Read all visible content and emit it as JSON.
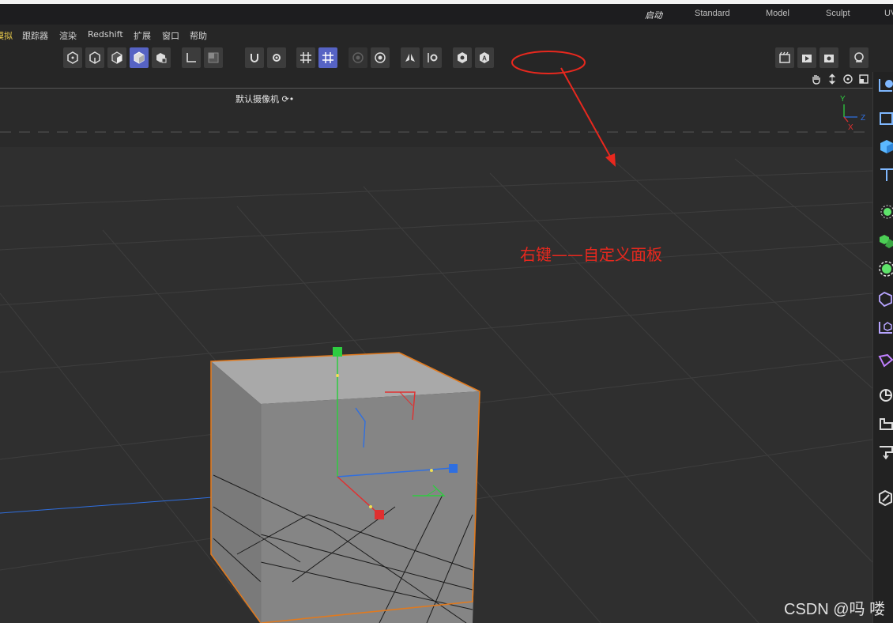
{
  "layout_tabs": [
    "启动",
    "Standard",
    "Model",
    "Sculpt",
    "UV"
  ],
  "menu": [
    "模拟",
    "跟踪器",
    "渲染",
    "Redshift",
    "扩展",
    "窗口",
    "帮助"
  ],
  "viewport": {
    "camera_label": "默认摄像机 ⟳•"
  },
  "axis_gizmo": {
    "y": "Y",
    "z": "Z",
    "x": "X"
  },
  "annotation": {
    "text": "右键——自定义面板",
    "color": "#e8281e"
  },
  "watermark": "CSDN @吗 喽",
  "colors": {
    "accent": "#5663c4",
    "selection_outline": "#e07a1f",
    "axis_x": "#e03030",
    "axis_y": "#2ecc40",
    "axis_z": "#2f6fe0"
  }
}
